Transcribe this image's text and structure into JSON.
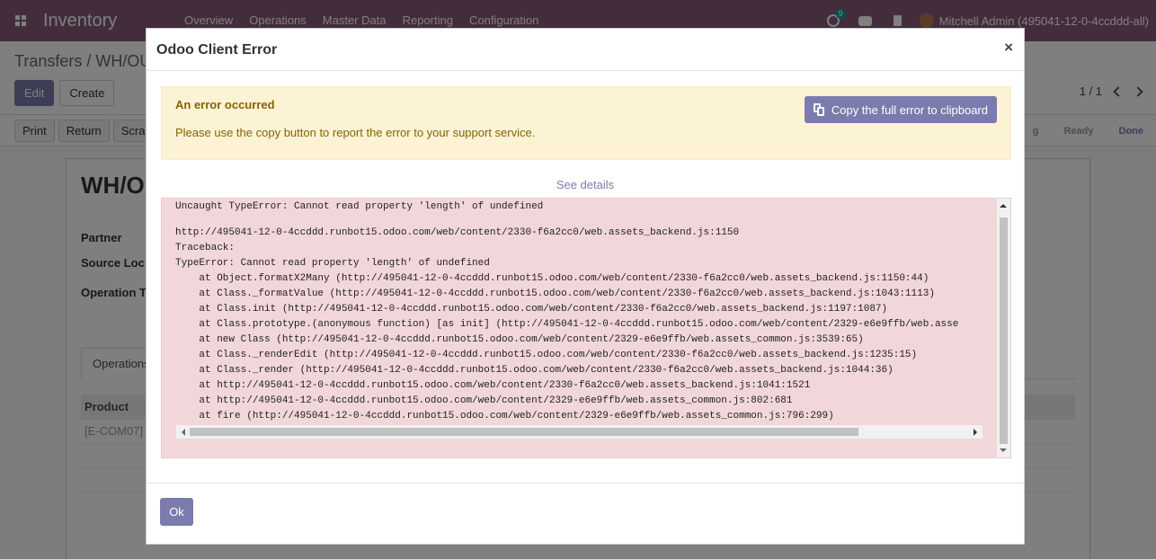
{
  "navbar": {
    "app_name": "Inventory",
    "menu": [
      "Overview",
      "Operations",
      "Master Data",
      "Reporting",
      "Configuration"
    ],
    "activity_badge": "9",
    "user": "Mitchell Admin (495041-12-0-4ccddd-all)"
  },
  "control_panel": {
    "breadcrumb": "Transfers / WH/OU",
    "edit_label": "Edit",
    "create_label": "Create",
    "pager": "1 / 1"
  },
  "statusbar": {
    "buttons": [
      "Print",
      "Return",
      "Scra"
    ],
    "stages": [
      "g",
      "Ready",
      "Done"
    ]
  },
  "form": {
    "title": "WH/O",
    "labels": [
      "Partner",
      "Source Loc",
      "Operation T"
    ],
    "tab": "Operations",
    "column": "Product",
    "first_row": "[E-COM07]"
  },
  "dialog": {
    "title": "Odoo Client Error",
    "close": "×",
    "alert_heading": "An error occurred",
    "alert_text": "Please use the copy button to report the error to your support service.",
    "copy_button": "Copy the full error to clipboard",
    "see_details": "See details",
    "error_first_line": "Uncaught TypeError: Cannot read property 'length' of undefined",
    "error_body": "http://495041-12-0-4ccddd.runbot15.odoo.com/web/content/2330-f6a2cc0/web.assets_backend.js:1150\nTraceback:\nTypeError: Cannot read property 'length' of undefined\n    at Object.formatX2Many (http://495041-12-0-4ccddd.runbot15.odoo.com/web/content/2330-f6a2cc0/web.assets_backend.js:1150:44)\n    at Class._formatValue (http://495041-12-0-4ccddd.runbot15.odoo.com/web/content/2330-f6a2cc0/web.assets_backend.js:1043:1113)\n    at Class.init (http://495041-12-0-4ccddd.runbot15.odoo.com/web/content/2330-f6a2cc0/web.assets_backend.js:1197:1087)\n    at Class.prototype.(anonymous function) [as init] (http://495041-12-0-4ccddd.runbot15.odoo.com/web/content/2329-e6e9ffb/web.asse\n    at new Class (http://495041-12-0-4ccddd.runbot15.odoo.com/web/content/2329-e6e9ffb/web.assets_common.js:3539:65)\n    at Class._renderEdit (http://495041-12-0-4ccddd.runbot15.odoo.com/web/content/2330-f6a2cc0/web.assets_backend.js:1235:15)\n    at Class._render (http://495041-12-0-4ccddd.runbot15.odoo.com/web/content/2330-f6a2cc0/web.assets_backend.js:1044:36)\n    at http://495041-12-0-4ccddd.runbot15.odoo.com/web/content/2330-f6a2cc0/web.assets_backend.js:1041:1521\n    at http://495041-12-0-4ccddd.runbot15.odoo.com/web/content/2329-e6e9ffb/web.assets_common.js:802:681\n    at fire (http://495041-12-0-4ccddd.runbot15.odoo.com/web/content/2329-e6e9ffb/web.assets_common.js:796:299)",
    "ok_button": "Ok"
  }
}
